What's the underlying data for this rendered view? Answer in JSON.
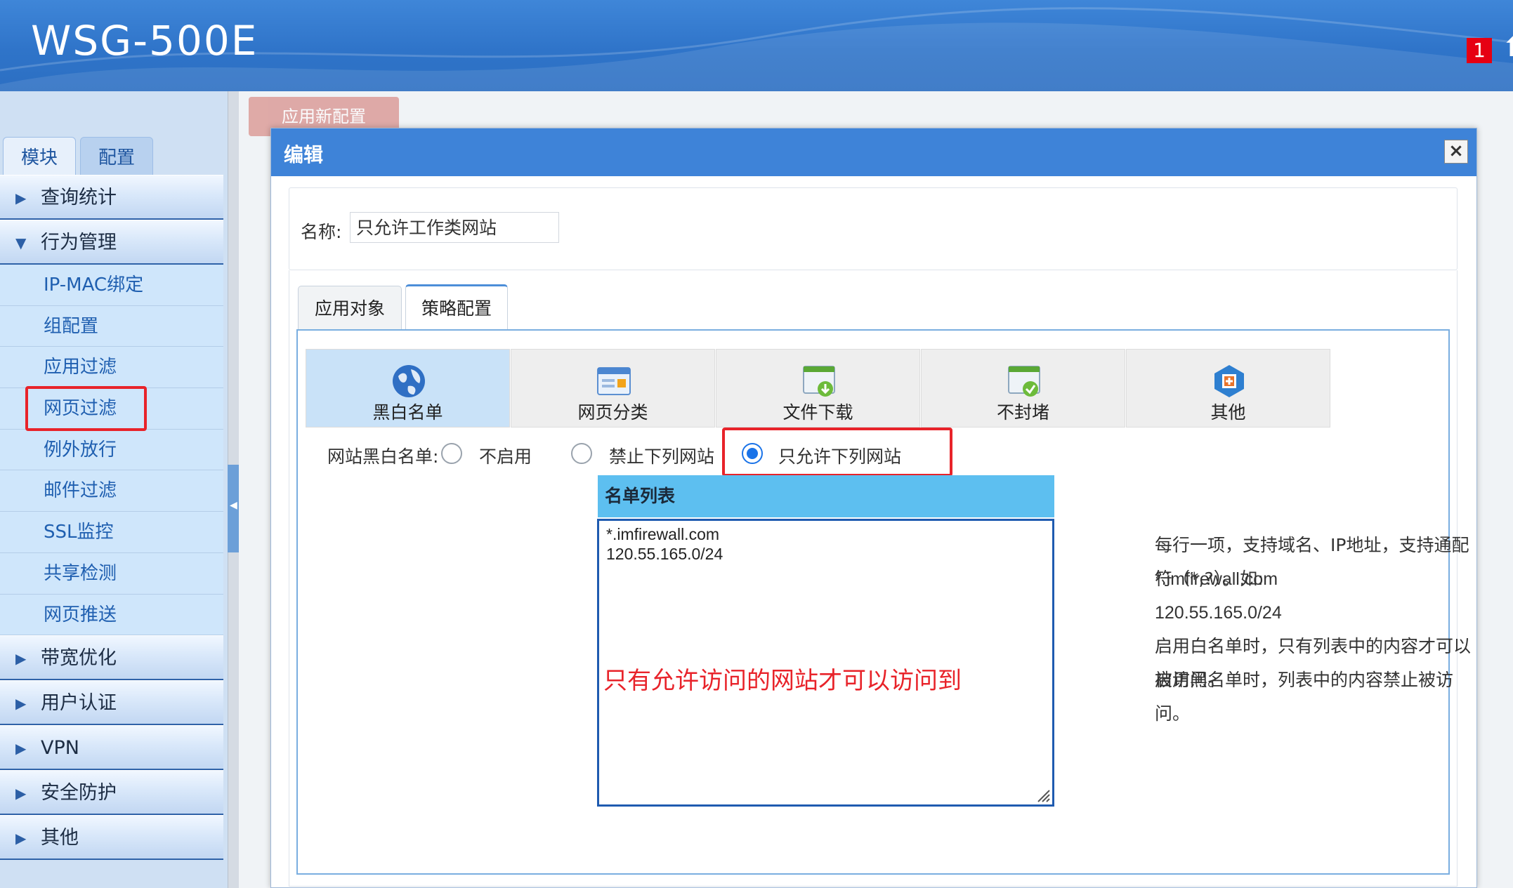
{
  "header": {
    "brand": "WSG-500E",
    "notification_count": "1"
  },
  "sidebar": {
    "tabs": [
      {
        "label": "模块"
      },
      {
        "label": "配置"
      }
    ],
    "groups": [
      {
        "label": "查询统计"
      },
      {
        "label": "行为管理"
      },
      {
        "label": "带宽优化"
      },
      {
        "label": "用户认证"
      },
      {
        "label": "VPN"
      },
      {
        "label": "安全防护"
      },
      {
        "label": "其他"
      }
    ],
    "sub_items": [
      {
        "label": "IP-MAC绑定"
      },
      {
        "label": "组配置"
      },
      {
        "label": "应用过滤"
      },
      {
        "label": "网页过滤"
      },
      {
        "label": "例外放行"
      },
      {
        "label": "邮件过滤"
      },
      {
        "label": "SSL监控"
      },
      {
        "label": "共享检测"
      },
      {
        "label": "网页推送"
      }
    ]
  },
  "background": {
    "apply_button": "应用新配置"
  },
  "dialog": {
    "title": "编辑",
    "close": "×",
    "name_label": "名称:",
    "name_value": "只允许工作类网站",
    "tabs": [
      {
        "label": "应用对象"
      },
      {
        "label": "策略配置"
      }
    ],
    "categories": [
      {
        "label": "黑白名单",
        "icon": "globe-icon"
      },
      {
        "label": "网页分类",
        "icon": "web-category-icon"
      },
      {
        "label": "文件下载",
        "icon": "file-download-icon"
      },
      {
        "label": "不封堵",
        "icon": "no-block-icon"
      },
      {
        "label": "其他",
        "icon": "other-icon"
      }
    ],
    "radio_label": "网站黑白名单:",
    "radio_options": [
      {
        "label": "不启用",
        "selected": false
      },
      {
        "label": "禁止下列网站",
        "selected": false
      },
      {
        "label": "只允许下列网站",
        "selected": true
      }
    ],
    "list_header": "名单列表",
    "list_lines": [
      "*.imfirewall.com",
      "120.55.165.0/24"
    ],
    "annotation": "只有允许访问的网站才可以访问到",
    "help": [
      "每行一项，支持域名、IP地址，支持通配符（*,?）。如:",
      "*.imfirewall.com",
      "120.55.165.0/24",
      "启用白名单时，只有列表中的内容才可以被访问。",
      "启用黑名单时，列表中的内容禁止被访问。"
    ]
  },
  "colors": {
    "header_blue": "#2f74c9",
    "highlight_red": "#e8232a",
    "accent_blue": "#1a73e8"
  }
}
